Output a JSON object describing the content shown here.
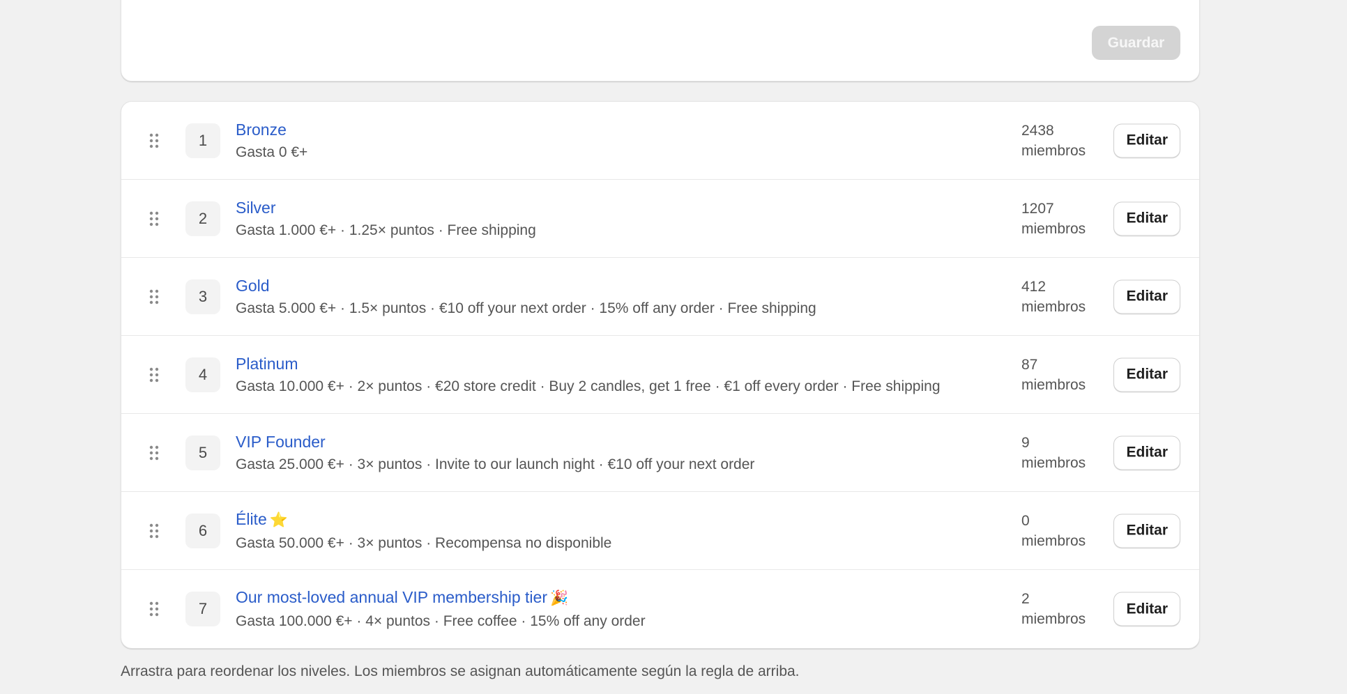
{
  "save_button": "Guardar",
  "edit_label": "Editar",
  "members_label": "miembros",
  "tiers": [
    {
      "position": "1",
      "name": "Bronze",
      "emoji": "",
      "description": "Gasta 0 €+",
      "members": "2438"
    },
    {
      "position": "2",
      "name": "Silver",
      "emoji": "",
      "description": "Gasta 1.000 €+ · 1.25× puntos · Free shipping",
      "members": "1207"
    },
    {
      "position": "3",
      "name": "Gold",
      "emoji": "",
      "description": "Gasta 5.000 €+ · 1.5× puntos · €10 off your next order · 15% off any order · Free shipping",
      "members": "412"
    },
    {
      "position": "4",
      "name": "Platinum",
      "emoji": "",
      "description": "Gasta 10.000 €+ · 2× puntos · €20 store credit · Buy 2 candles, get 1 free · €1 off every order · Free shipping",
      "members": "87"
    },
    {
      "position": "5",
      "name": "VIP Founder",
      "emoji": "",
      "description": "Gasta 25.000 €+ · 3× puntos · Invite to our launch night · €10 off your next order",
      "members": "9"
    },
    {
      "position": "6",
      "name": "Élite",
      "emoji": "⭐",
      "description": "Gasta 50.000 €+ · 3× puntos · Recompensa no disponible",
      "members": "0"
    },
    {
      "position": "7",
      "name": "Our most-loved annual VIP membership tier",
      "emoji": "🎉",
      "description": "Gasta 100.000 €+ · 4× puntos · Free coffee · 15% off any order",
      "members": "2"
    }
  ],
  "footnote": "Arrastra para reordenar los niveles. Los miembros se asignan automáticamente según la regla de arriba.",
  "colors": {
    "link": "#2a5cc9",
    "background": "#f1f1f1",
    "disabled_button": "#d4d4d4"
  },
  "icons": {
    "drag_handle": "drag-handle-icon"
  }
}
